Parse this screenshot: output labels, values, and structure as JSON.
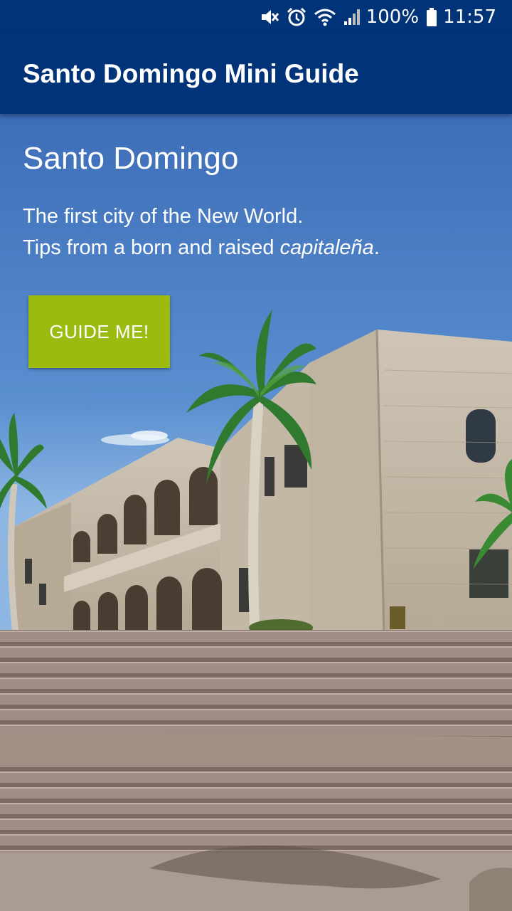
{
  "status_bar": {
    "battery_percent": "100%",
    "time": "11:57",
    "icons": [
      "mute-icon",
      "alarm-icon",
      "wifi-icon",
      "signal-icon",
      "battery-icon"
    ]
  },
  "app_bar": {
    "title": "Santo Domingo Mini Guide",
    "background_color": "#003377"
  },
  "hero": {
    "title": "Santo Domingo",
    "tagline_line1": "The first city of the New World.",
    "tagline_line2_prefix": "Tips from a born and raised ",
    "tagline_line2_emphasis": "capitaleña",
    "tagline_line2_suffix": ".",
    "image_subject": "Alcázar de Colón with palm trees and stone steps"
  },
  "cta": {
    "label": "GUIDE ME!",
    "color": "#9cbb11"
  }
}
